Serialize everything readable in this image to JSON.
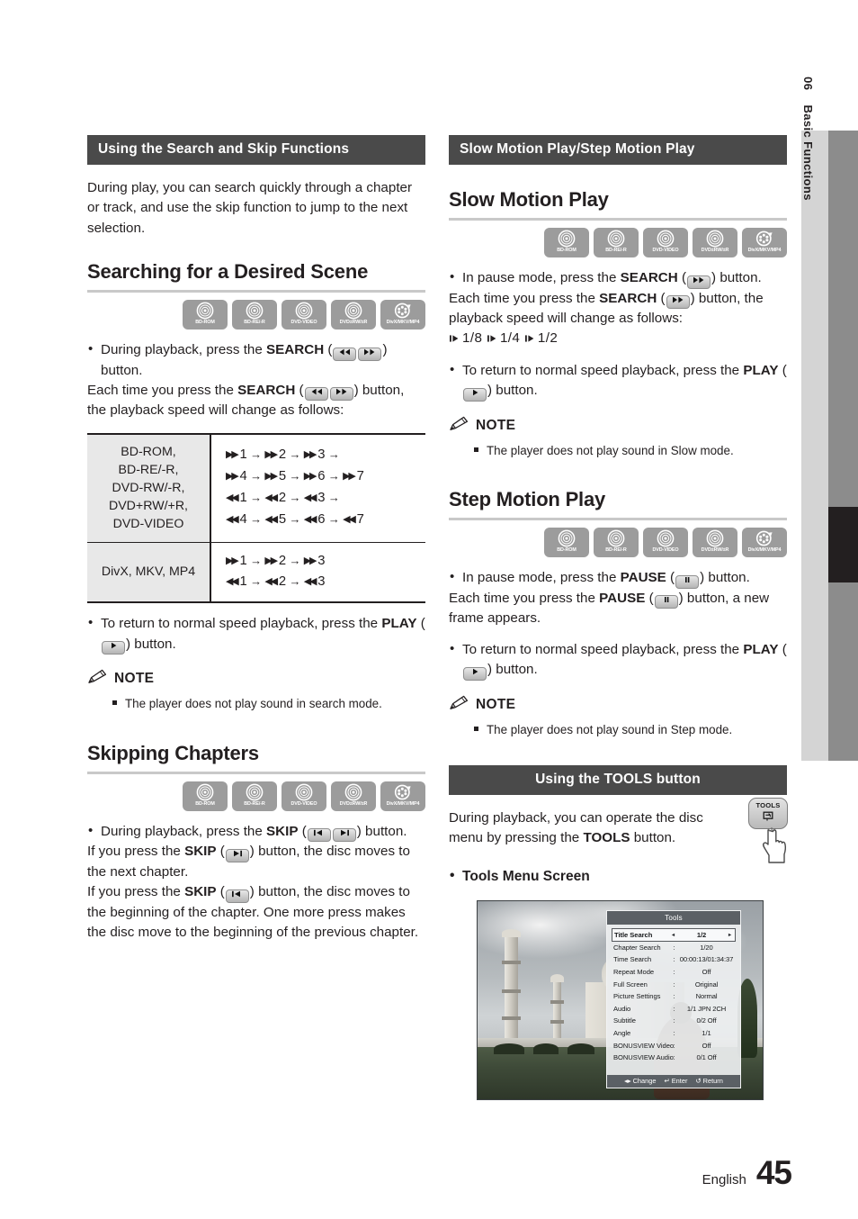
{
  "sidebar": {
    "chapter_number": "06",
    "chapter_title": "Basic Functions"
  },
  "left_column": {
    "section_bar": "Using the Search and Skip Functions",
    "intro": "During play, you can search quickly through a chapter or track, and use the skip function to jump to the next selection.",
    "heading1": "Searching for a Desired Scene",
    "discs": [
      {
        "label": "BD-ROM",
        "icon": "disc-icon"
      },
      {
        "label": "BD-RE/-R",
        "icon": "disc-icon"
      },
      {
        "label": "DVD-VIDEO",
        "icon": "disc-icon"
      },
      {
        "label": "DVD±RW/±R",
        "icon": "disc-icon"
      },
      {
        "label": "DivX/MKV/MP4",
        "icon": "film-reel-icon"
      }
    ],
    "b1_pre": "During playback, press the ",
    "b1_bold": "SEARCH",
    "b1_post": " button.",
    "b2_pre": "Each time you press the ",
    "b2_bold": "SEARCH",
    "b2_post": " button, the playback speed will change as follows:",
    "table": {
      "rows": [
        {
          "formats": "BD-ROM,\nBD-RE/-R,\nDVD-RW/-R,\nDVD+RW/+R,\nDVD-VIDEO",
          "sequences": [
            {
              "dir": "ff",
              "steps": [
                "1",
                "2",
                "3"
              ],
              "trailing_arrow": true
            },
            {
              "dir": "ff",
              "steps": [
                "4",
                "5",
                "6",
                "7"
              ],
              "trailing_arrow": false
            },
            {
              "dir": "rw",
              "steps": [
                "1",
                "2",
                "3"
              ],
              "trailing_arrow": true
            },
            {
              "dir": "rw",
              "steps": [
                "4",
                "5",
                "6",
                "7"
              ],
              "trailing_arrow": false
            }
          ]
        },
        {
          "formats": "DivX, MKV, MP4",
          "sequences": [
            {
              "dir": "ff",
              "steps": [
                "1",
                "2",
                "3"
              ],
              "trailing_arrow": false
            },
            {
              "dir": "rw",
              "steps": [
                "1",
                "2",
                "3"
              ],
              "trailing_arrow": false
            }
          ]
        }
      ]
    },
    "b3_pre": "To return to normal speed playback, press the ",
    "b3_bold": "PLAY",
    "b3_post": " button.",
    "note_label": "NOTE",
    "note_item": "The player does not play sound in search mode.",
    "heading2": "Skipping Chapters",
    "b4_pre": "During playback, press the ",
    "b4_bold": "SKIP",
    "b4_post": " button.",
    "b5_pre": "If you press the ",
    "b5_bold": "SKIP",
    "b5_post": " button, the disc moves to the next chapter.",
    "b6_pre": "If you press the ",
    "b6_bold": "SKIP",
    "b6_post": " button, the disc moves to the beginning of the chapter. One more press makes the disc move to the beginning of the previous chapter."
  },
  "right_column": {
    "section_bar": "Slow Motion Play/Step Motion Play",
    "heading1": "Slow Motion Play",
    "discs": [
      {
        "label": "BD-ROM",
        "icon": "disc-icon"
      },
      {
        "label": "BD-RE/-R",
        "icon": "disc-icon"
      },
      {
        "label": "DVD-VIDEO",
        "icon": "disc-icon"
      },
      {
        "label": "DVD±RW/±R",
        "icon": "disc-icon"
      },
      {
        "label": "DivX/MKV/MP4",
        "icon": "film-reel-icon"
      }
    ],
    "s1_pre": "In pause mode, press the ",
    "s1_bold": "SEARCH",
    "s1_post": " button.",
    "s2_pre": "Each time you press the ",
    "s2_bold": "SEARCH",
    "s2_post": " button, the playback speed will change as follows:",
    "slow_speeds": [
      "1/8",
      "1/4",
      "1/2"
    ],
    "s3_pre": "To return to normal speed playback, press the ",
    "s3_bold": "PLAY",
    "s3_post": " button.",
    "note_label": "NOTE",
    "note_item": "The player does not play sound in Slow mode.",
    "heading2": "Step Motion Play",
    "s4_pre": "In pause mode, press the ",
    "s4_bold": "PAUSE",
    "s4_post": " button.",
    "s5_pre": "Each time you press the ",
    "s5_bold": "PAUSE",
    "s5_post": " button, a new frame appears.",
    "s6_pre": "To return to normal speed playback, press the ",
    "s6_bold": "PLAY",
    "s6_post": " button.",
    "note2_label": "NOTE",
    "note2_item": "The player does not play sound in Step mode.",
    "tools_bar": "Using the TOOLS button",
    "tools_pre": "During playback, you can operate the disc menu by pressing the ",
    "tools_bold": "TOOLS",
    "tools_post": " button.",
    "tools_btn_label": "TOOLS",
    "tools_caption": "Tools Menu Screen"
  },
  "tools_screen": {
    "title": "Tools",
    "rows": [
      {
        "key": "Title Search",
        "sep": "‹",
        "value": "1/2",
        "selected": true
      },
      {
        "key": "Chapter Search",
        "sep": ":",
        "value": "1/20",
        "selected": false
      },
      {
        "key": "Time Search",
        "sep": ":",
        "value": "00:00:13/01:34:37",
        "selected": false
      },
      {
        "key": "Repeat Mode",
        "sep": ":",
        "value": "Off",
        "selected": false
      },
      {
        "key": "Full Screen",
        "sep": ":",
        "value": "Original",
        "selected": false
      },
      {
        "key": "Picture Settings",
        "sep": ":",
        "value": "Normal",
        "selected": false
      },
      {
        "key": "Audio",
        "sep": ":",
        "value": "1/1 JPN 2CH",
        "selected": false
      },
      {
        "key": "Subtitle",
        "sep": ":",
        "value": "0/2 Off",
        "selected": false
      },
      {
        "key": "Angle",
        "sep": ":",
        "value": "1/1",
        "selected": false
      },
      {
        "key": "BONUSVIEW Video",
        "sep": ":",
        "value": "Off",
        "selected": false
      },
      {
        "key": "BONUSVIEW Audio",
        "sep": ":",
        "value": "0/1 Off",
        "selected": false
      }
    ],
    "footer": [
      "◂▸ Change",
      "↵ Enter",
      "↺ Return"
    ]
  },
  "footer": {
    "language": "English",
    "page_number": "45"
  },
  "colors": {
    "header_bar": "#4a4a4a",
    "text": "#231f20",
    "rule": "#c9c9c9",
    "table_shade": "#e8e8e8",
    "disc_badge": "#9c9c9c",
    "sidebar_light": "#d4d4d4",
    "sidebar_strip": "#8c8c8c"
  }
}
